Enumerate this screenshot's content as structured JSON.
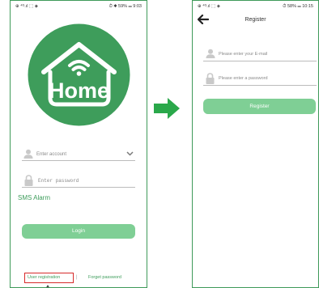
{
  "login_screen": {
    "status_left": "⊕ ⁴ᴳ.ıl ⬚ ◈",
    "status_right": "⏱ ✱ 59% ▭ 9:03",
    "account_placeholder": "Enter account",
    "password_placeholder": "Enter password",
    "sms_alarm": "SMS Alarm",
    "login_button": "Login",
    "user_registration": "User registration",
    "separator": "|",
    "forget_password": "Forget password",
    "logo_text": "Home"
  },
  "register_screen": {
    "status_left": "⊕ ⁴ᴳ.ıl ⬚ ◈",
    "status_right": "⏱ 58% ▭ 10:15",
    "title": "Register",
    "email_placeholder": "Please enter your E-mail",
    "password_placeholder": "Please enter a password",
    "register_button": "Register"
  },
  "colors": {
    "brand_green": "#3e9d5b",
    "button_green": "#7fcf95",
    "highlight_red": "#d62a2a"
  },
  "icons": [
    "person-icon",
    "lock-icon",
    "chevron-down-icon",
    "back-arrow-icon",
    "wifi-icon",
    "next-arrow-icon"
  ]
}
